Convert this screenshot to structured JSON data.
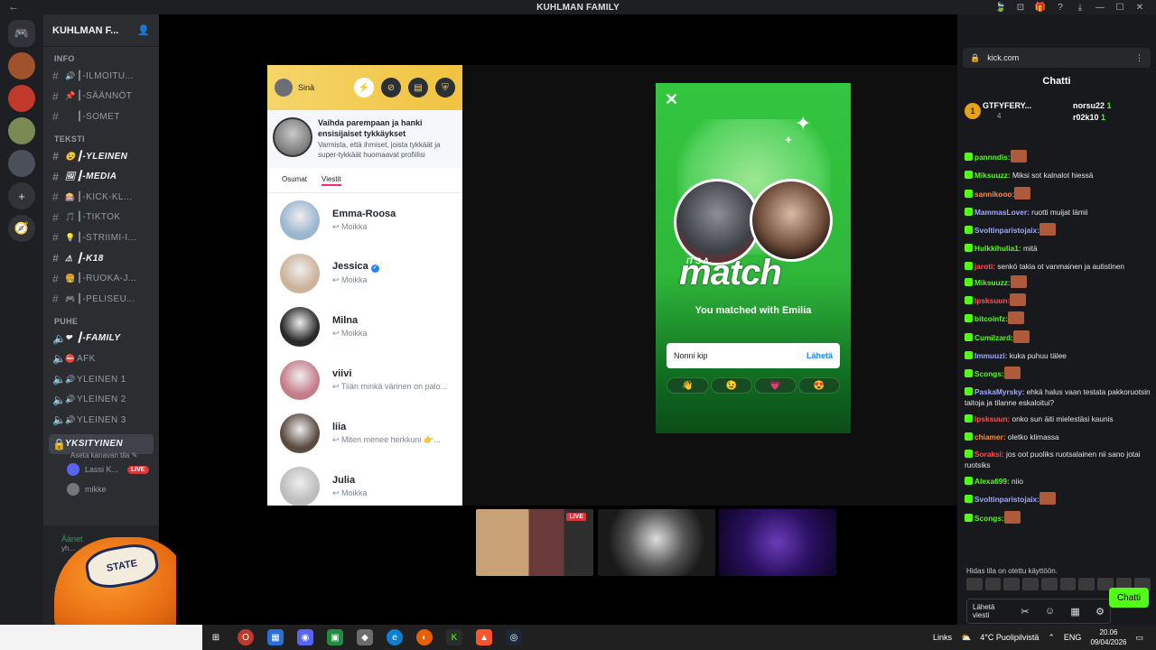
{
  "window": {
    "title": "KUHLMAN FAMILY",
    "back_label": "←",
    "controls": [
      "🍃",
      "⊡",
      "🎁",
      "?",
      "⤓",
      "—",
      "☐",
      "✕"
    ]
  },
  "rail": {
    "items": [
      "discord-home",
      "server-1",
      "server-2",
      "server-3",
      "server-4",
      "add-server",
      "explore"
    ]
  },
  "server": {
    "name": "KUHLMAN F...",
    "categories": [
      {
        "label": "INFO",
        "channels": [
          {
            "emoji": "🔊",
            "name": "┃-ILMOITU..."
          },
          {
            "emoji": "📌",
            "name": "┃-SÄÄNNÖT"
          },
          {
            "emoji": "",
            "name": "┃-SOMET"
          }
        ]
      },
      {
        "label": "TEKSTI",
        "channels": [
          {
            "emoji": "😉",
            "name": "┃-YLEINEN"
          },
          {
            "emoji": "🖼",
            "name": "┃-MEDIA"
          },
          {
            "emoji": "🎰",
            "name": "┃-KICK-KL..."
          },
          {
            "emoji": "🎵",
            "name": "┃-TIKTOK"
          },
          {
            "emoji": "💡",
            "name": "┃-STRIIMI-I..."
          },
          {
            "emoji": "⚠",
            "name": "┃-K18"
          },
          {
            "emoji": "🍔",
            "name": "┃-RUOKA-J..."
          },
          {
            "emoji": "🎮",
            "name": "┃-PELISEU..."
          }
        ]
      },
      {
        "label": "PUHE",
        "channels": [
          {
            "emoji": "❤",
            "name": "┃-FAMILY"
          },
          {
            "emoji": "⛔",
            "name": "AFK"
          },
          {
            "emoji": "🔊",
            "name": "YLEINEN 1"
          },
          {
            "emoji": "🔊",
            "name": "YLEINEN 2"
          },
          {
            "emoji": "🔊",
            "name": "YLEINEN 3"
          }
        ]
      }
    ],
    "selected_voice": {
      "name": "YKSITYINEN",
      "status": "Aseta kanavan tila ✎"
    },
    "voice_users": [
      {
        "name": "Lassi K...",
        "live": "LIVE"
      },
      {
        "name": "mikke",
        "live": ""
      }
    ],
    "voice_panel": {
      "status": "Äänet",
      "sub": "yh..."
    }
  },
  "tinder": {
    "user": "Sinä",
    "promo_title": "Vaihda parempaan ja hanki ensisijaiset tykkäykset",
    "promo_text": "Varmista, että ihmiset, joista tykkäät ja super-tykkäät huomaavat profiilisi",
    "tab_matches": "Osumat",
    "tab_messages": "Viestit",
    "conversations": [
      {
        "name": "Emma-Roosa",
        "msg": "↩ Moikka",
        "verified": false,
        "color": "#9bb6cf"
      },
      {
        "name": "Jessica",
        "msg": "↩ Moikka",
        "verified": true,
        "color": "#cdb39a"
      },
      {
        "name": "Milna",
        "msg": "↩ Moikka",
        "verified": false,
        "color": "#2a2a2a"
      },
      {
        "name": "viivi",
        "msg": "↩ Tiiän minkä värinen on palo...",
        "verified": false,
        "color": "#c57c8a"
      },
      {
        "name": "liia",
        "msg": "↩ Miten menee herkkuni 👉...",
        "verified": false,
        "color": "#5b4a40"
      },
      {
        "name": "Julia",
        "msg": "↩ Moikka",
        "verified": false,
        "color": "#bdbdbd"
      }
    ]
  },
  "match": {
    "its_a": "IT'S A",
    "word": "match",
    "subtitle": "You matched with Emilia",
    "input_value": "Nonni kip",
    "send_label": "Lähetä",
    "emojis": [
      "👋",
      "😉",
      "💗",
      "😍"
    ]
  },
  "thumbnails": {
    "live_label": "LIVE"
  },
  "browser": {
    "url": "kick.com",
    "chat_title": "Chatti",
    "top_gifter": "GTFYFERY...",
    "top_gifter_count": "4",
    "gifter2": "norsu22",
    "gifter2_count": "1",
    "gifter3": "r02k10",
    "gifter3_count": "1",
    "messages": [
      {
        "user": "pannndis:",
        "color": "#53fc18",
        "text": "",
        "emote": true
      },
      {
        "user": "Miksuuzz:",
        "color": "#53fc18",
        "text": " Miksi sot kalnalot hiessä",
        "emote": false
      },
      {
        "user": "sannikooo:",
        "color": "#ff8a3d",
        "text": "",
        "emote": true
      },
      {
        "user": "MammasLover:",
        "color": "#9fa8ff",
        "text": " ruotti muijat lämii",
        "emote": false
      },
      {
        "user": "Svoltinparistojaix:",
        "color": "#9fa8ff",
        "text": "",
        "emote": true
      },
      {
        "user": "Hulkkihulia1:",
        "color": "#53fc18",
        "text": " mitä",
        "emote": false
      },
      {
        "user": "jaroti:",
        "color": "#ff4f4f",
        "text": " senkö takia ot vanmainen ja autistinen",
        "emote": false,
        "two": true
      },
      {
        "user": "Miksuuzz:",
        "color": "#53fc18",
        "text": "",
        "emote": true
      },
      {
        "user": "lpsksuun:",
        "color": "#ff4f4f",
        "text": "",
        "emote": true
      },
      {
        "user": "bitcoinfz:",
        "color": "#53fc18",
        "text": "",
        "emote": true
      },
      {
        "user": "Cumilzard:",
        "color": "#53fc18",
        "text": "",
        "emote": true
      },
      {
        "user": "Immuuzi:",
        "color": "#9fa8ff",
        "text": " kuka puhuu tälee",
        "emote": false
      },
      {
        "user": "Scongs:",
        "color": "#53fc18",
        "text": "",
        "emote": true
      },
      {
        "user": "PaskaMyrsky:",
        "color": "#9fa8ff",
        "text": " ehkä halus vaan testata pakkoruotsin taitoja ja tilanne eskaloitui?",
        "emote": false,
        "two": true
      },
      {
        "user": "lpsksuun:",
        "color": "#ff4f4f",
        "text": " onko sun äiti mielestäsi kaunis",
        "emote": false
      },
      {
        "user": "chiamer:",
        "color": "#ff8a3d",
        "text": " oletko klimassa",
        "emote": false
      },
      {
        "user": "Soraksi:",
        "color": "#ff4f4f",
        "text": " jos oot puoliks ruotsalainen nii sano jotai ruotsiks",
        "emote": false,
        "two": true
      },
      {
        "user": "Alexa699:",
        "color": "#53fc18",
        "text": " niio",
        "emote": false
      },
      {
        "user": "Svoltinparistojaix:",
        "color": "#9fa8ff",
        "text": "",
        "emote": true
      },
      {
        "user": "Scongs:",
        "color": "#53fc18",
        "text": "",
        "emote": true
      }
    ],
    "notice": "Hidas tila on otettu käyttöön.",
    "input_placeholder": "Lähetä viesti",
    "send_label": "Chatti"
  },
  "taskbar": {
    "links_label": "Links",
    "weather": "4°C Puolipilvistä",
    "lang": "ENG",
    "time": "20.06",
    "date": "09/04/2026"
  }
}
